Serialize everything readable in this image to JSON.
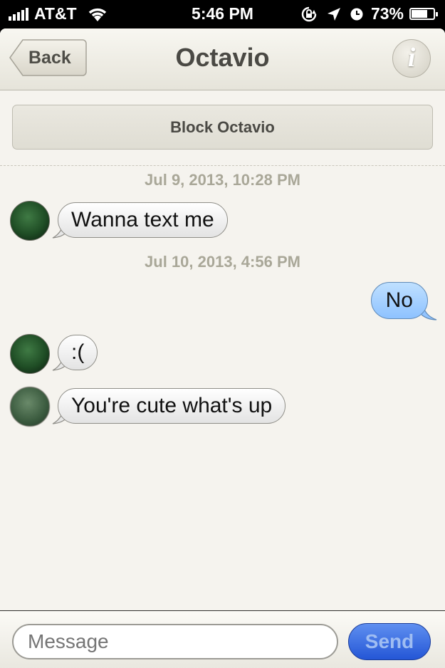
{
  "status_bar": {
    "carrier": "AT&T",
    "time": "5:46 PM",
    "battery_percent": "73%",
    "battery_level": 0.73,
    "icons": [
      "signal-bars-icon",
      "wifi-icon",
      "rotation-lock-icon",
      "location-arrow-icon",
      "alarm-clock-icon",
      "battery-icon"
    ]
  },
  "nav": {
    "back_label": "Back",
    "title": "Octavio",
    "info_glyph": "i"
  },
  "block_label": "Block Octavio",
  "conversation": {
    "timestamps": [
      "Jul 9, 2013, 10:28 PM",
      "Jul 10, 2013, 4:56 PM"
    ],
    "messages": [
      {
        "direction": "incoming",
        "text": "Wanna text me"
      },
      {
        "direction": "outgoing",
        "text": "No"
      },
      {
        "direction": "incoming",
        "text": ":("
      },
      {
        "direction": "incoming",
        "text": "You're cute what's up"
      }
    ]
  },
  "composer": {
    "placeholder": "Message",
    "send_label": "Send"
  },
  "colors": {
    "incoming_bubble": "#f0f0f0",
    "outgoing_bubble": "#a8d1ff",
    "send_button": "#2f62dc",
    "background": "#f5f3ee"
  }
}
